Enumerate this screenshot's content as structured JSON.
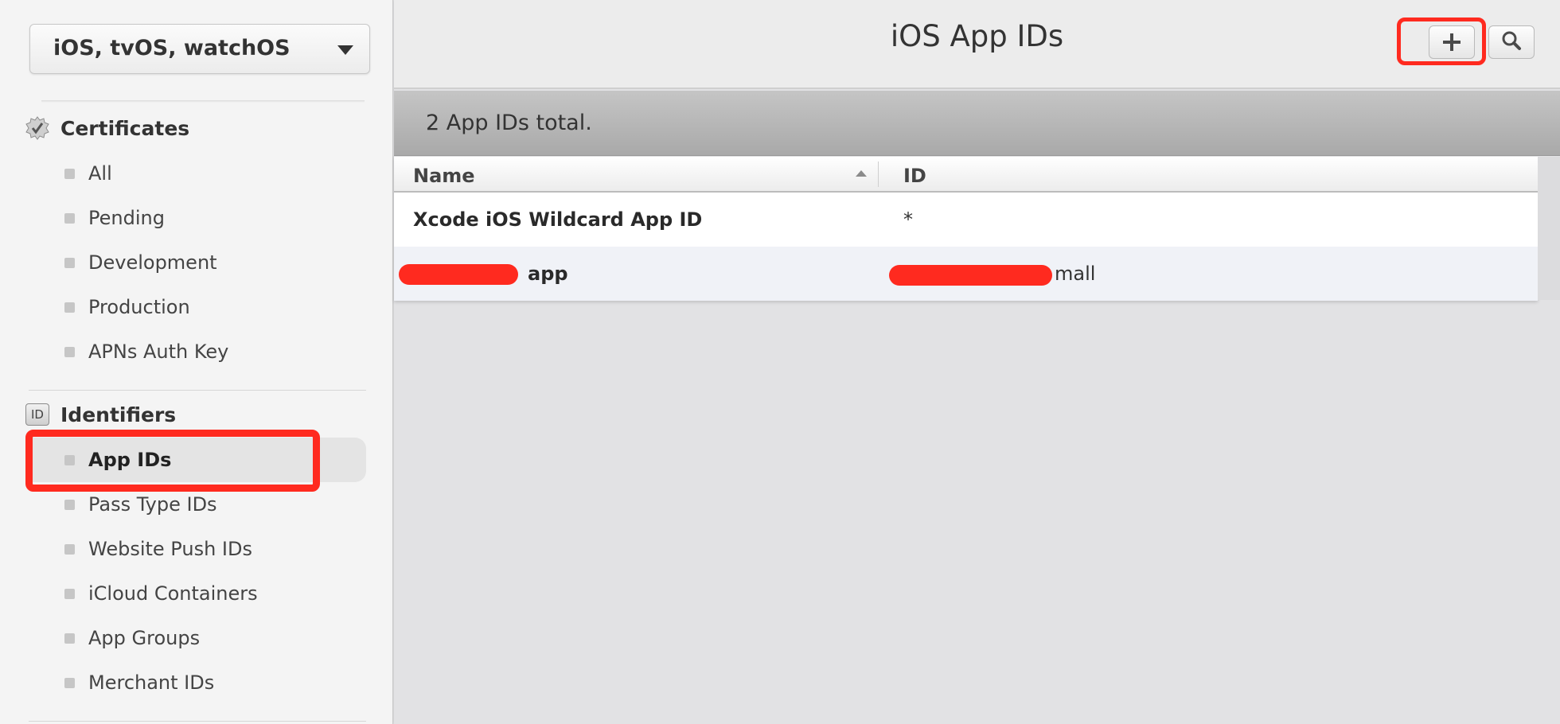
{
  "sidebar": {
    "platform": "iOS, tvOS, watchOS",
    "certificates": {
      "title": "Certificates",
      "items": [
        "All",
        "Pending",
        "Development",
        "Production",
        "APNs Auth Key"
      ]
    },
    "identifiers": {
      "title": "Identifiers",
      "icon_label": "ID",
      "items": [
        "App IDs",
        "Pass Type IDs",
        "Website Push IDs",
        "iCloud Containers",
        "App Groups",
        "Merchant IDs"
      ],
      "active": "App IDs"
    }
  },
  "main": {
    "title": "iOS App IDs",
    "summary": "2  App IDs total.",
    "table": {
      "columns": [
        "Name",
        "ID"
      ],
      "rows": [
        {
          "name": "Xcode iOS Wildcard App ID",
          "id": "*"
        },
        {
          "name": "app",
          "id": "mall"
        }
      ]
    }
  },
  "colors": {
    "highlight": "#ff2a1f",
    "sidebar_bg": "#f4f4f4",
    "main_bg": "#e2e2e4"
  }
}
